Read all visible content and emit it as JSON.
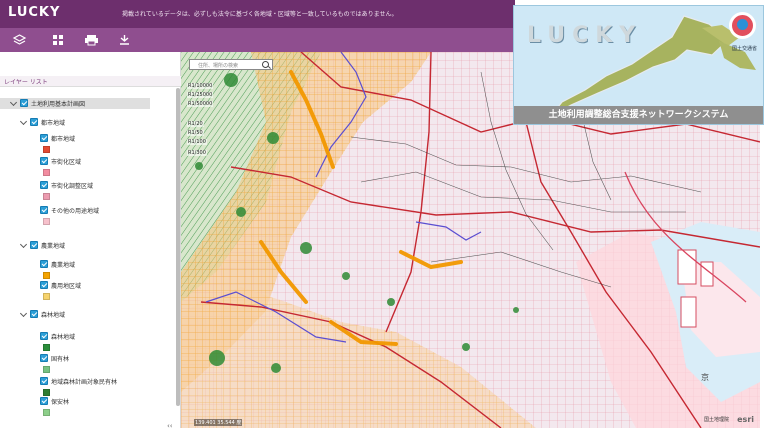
{
  "header": {
    "app_title": "LUCKY",
    "notice": "掲載されているデータは、必ずしも法令に基づく各地域・区域等と一致しているものではありません。"
  },
  "toolbar": {
    "icons": [
      "layers-icon",
      "grid-icon",
      "print-icon",
      "download-icon"
    ]
  },
  "panel": {
    "tab_label": "レイヤー リスト",
    "collapse_symbol": "‹‹",
    "tree": [
      {
        "label": "土地利用基本計画図",
        "level": 0,
        "checked": true,
        "root": true
      },
      {
        "label": "都市地域",
        "level": 1,
        "checked": true
      },
      {
        "label": "都市地域",
        "level": 2,
        "checked": true,
        "swatch": "#e34a33"
      },
      {
        "label": "市街化区域",
        "level": 2,
        "checked": true,
        "swatch": "#f28ca0"
      },
      {
        "label": "市街化調整区域",
        "level": 2,
        "checked": true,
        "swatch": "#ec9cb0"
      },
      {
        "label": "その他の用途地域",
        "level": 2,
        "checked": true,
        "swatch": "#f7c1cc"
      },
      {
        "label": "農業地域",
        "level": 1,
        "checked": true
      },
      {
        "label": "農業地域",
        "level": 2,
        "checked": true,
        "swatch": "#f4a300"
      },
      {
        "label": "農用地区域",
        "level": 2,
        "checked": true,
        "swatch": "#f6d36d"
      },
      {
        "label": "森林地域",
        "level": 1,
        "checked": true
      },
      {
        "label": "森林地域",
        "level": 2,
        "checked": true,
        "swatch": "#2a8d3a"
      },
      {
        "label": "国有林",
        "level": 2,
        "checked": true,
        "swatch": "#77c282"
      },
      {
        "label": "地域森林計画対象民有林",
        "level": 2,
        "checked": true,
        "swatch": "#2e7d32"
      },
      {
        "label": "保安林",
        "level": 2,
        "checked": true,
        "swatch": "#8dcf8a"
      }
    ]
  },
  "map": {
    "search_placeholder": "住所、場所の検索",
    "scale_tags": [
      "R1/10000",
      "R1/25000",
      "R1/50000",
      "R1/20",
      "R1/50",
      "R1/100",
      "R1/300"
    ],
    "credit": "国土地理院",
    "logo": "esri",
    "coord": "139.401 35.544 度",
    "place_label": "京"
  },
  "inset": {
    "title": "LUCKY",
    "subtitle": "土地利用調整総合支援ネットワークシステム",
    "ministry": "国土交通省"
  },
  "colors": {
    "header": "#6d2f6d",
    "toolbar": "#8f4e8f",
    "accent": "#2c9fd7"
  }
}
